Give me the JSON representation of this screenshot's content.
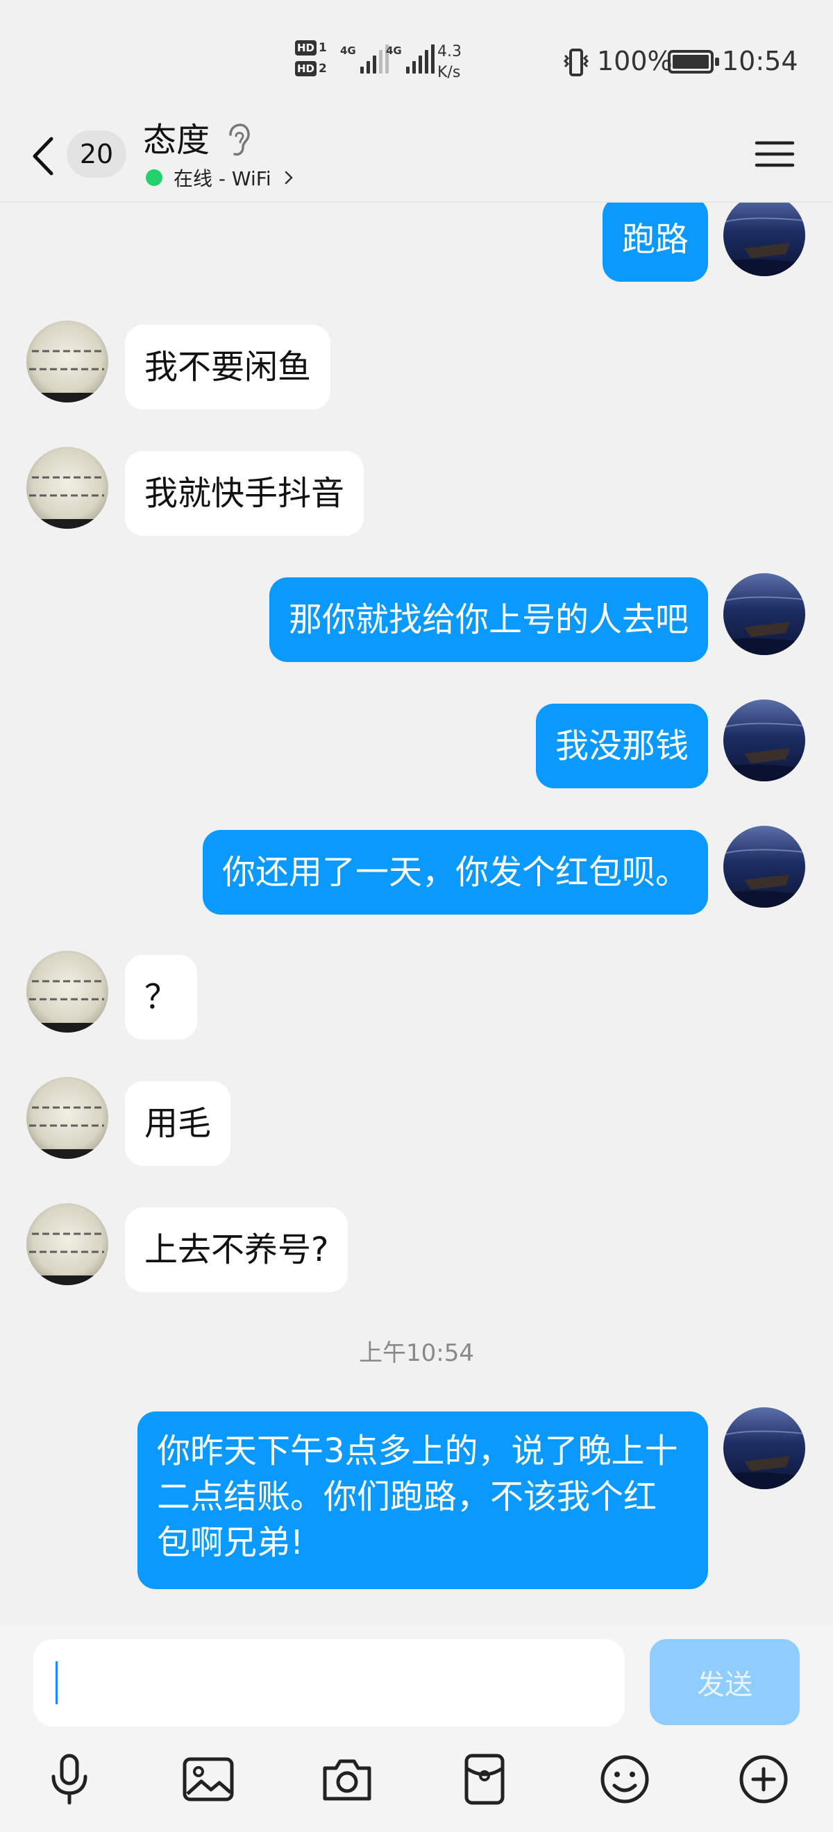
{
  "status_bar": {
    "hd1": "HD",
    "hd1_num": "1",
    "hd2": "HD",
    "hd2_num": "2",
    "sim1_gen": "4G",
    "sim2_gen": "4G",
    "speed_value": "4.3",
    "speed_unit": "K/s",
    "battery": "100%",
    "time": "10:54"
  },
  "header": {
    "unread_count": "20",
    "contact_name": "态度",
    "online_status": "在线 - WiFi"
  },
  "messages": [
    {
      "side": "out",
      "text": "跑路"
    },
    {
      "side": "in",
      "text": "我不要闲鱼"
    },
    {
      "side": "in",
      "text": "我就快手抖音"
    },
    {
      "side": "out",
      "text": "那你就找给你上号的人去吧"
    },
    {
      "side": "out",
      "text": "我没那钱"
    },
    {
      "side": "out",
      "text": "你还用了一天，你发个红包呗。"
    },
    {
      "side": "in",
      "text": "？"
    },
    {
      "side": "in",
      "text": "用毛"
    },
    {
      "side": "in",
      "text": "上去不养号?"
    },
    {
      "side": "time",
      "text": "上午10:54"
    },
    {
      "side": "out",
      "text": "你昨天下午3点多上的，说了晚上十二点结账。你们跑路，不该我个红包啊兄弟!"
    }
  ],
  "input": {
    "value": "",
    "send_label": "发送"
  },
  "icons": {
    "toolbar": [
      "microphone-icon",
      "image-icon",
      "camera-icon",
      "red-packet-icon",
      "emoji-icon",
      "plus-icon"
    ]
  },
  "colors": {
    "out_bubble": "#0a99ff",
    "in_bubble": "#ffffff",
    "background": "#f1f1f1",
    "online_dot": "#23d26b",
    "send_disabled": "#8ecdfc"
  }
}
